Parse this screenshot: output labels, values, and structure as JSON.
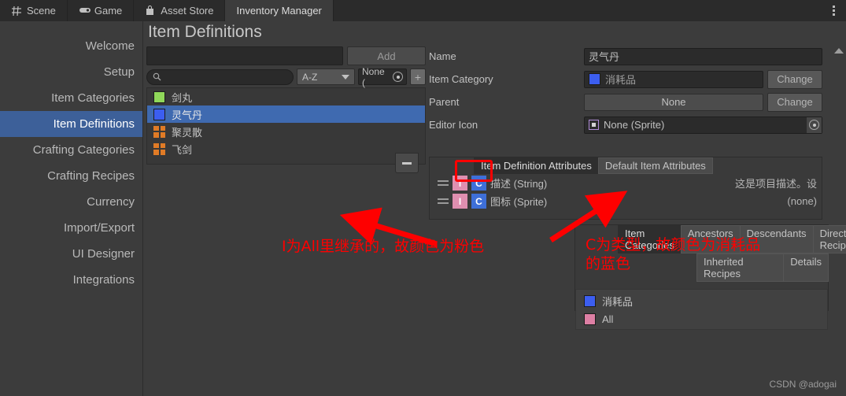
{
  "window": {
    "tabs": [
      {
        "label": "Scene",
        "icon": "grid-icon",
        "active": false
      },
      {
        "label": "Game",
        "icon": "gamepad-icon",
        "active": false
      },
      {
        "label": "Asset Store",
        "icon": "store-bag-icon",
        "active": false
      },
      {
        "label": "Inventory Manager",
        "icon": "none",
        "active": true
      }
    ],
    "menu_icon": "kebab-menu-icon"
  },
  "page_title": "Item Definitions",
  "sidebar": {
    "items": [
      {
        "label": "Welcome",
        "active": false
      },
      {
        "label": "Setup",
        "active": false
      },
      {
        "label": "Item Categories",
        "active": false
      },
      {
        "label": "Item Definitions",
        "active": true
      },
      {
        "label": "Crafting Categories",
        "active": false
      },
      {
        "label": "Crafting Recipes",
        "active": false
      },
      {
        "label": "Currency",
        "active": false
      },
      {
        "label": "Import/Export",
        "active": false
      },
      {
        "label": "UI Designer",
        "active": false
      },
      {
        "label": "Integrations",
        "active": false
      }
    ]
  },
  "item_pane": {
    "new_item_value": "",
    "new_item_placeholder": "",
    "add_label": "Add",
    "search_value": "",
    "search_placeholder": "",
    "search_icon": "search-icon",
    "sort_value": "A-Z",
    "filter_value": "None (",
    "filter_icon": "radio-select-icon",
    "add_filter_label": "+",
    "remove_label": "-",
    "items": [
      {
        "label": "剑丸",
        "icon": "color-swatch",
        "color": "#90d85a",
        "selected": false
      },
      {
        "label": "灵气丹",
        "icon": "color-swatch",
        "color": "#3c5ef0",
        "selected": true
      },
      {
        "label": "聚灵散",
        "icon": "grid-swatch",
        "color": "#e07b26",
        "selected": false
      },
      {
        "label": "飞剑",
        "icon": "grid-swatch",
        "color": "#e07b26",
        "selected": false
      }
    ]
  },
  "properties": {
    "name_label": "Name",
    "name_value": "灵气丹",
    "category_label": "Item Category",
    "category_value": "消耗品",
    "category_color": "#3c5ef0",
    "category_change_label": "Change",
    "parent_label": "Parent",
    "parent_value": "None",
    "parent_change_label": "Change",
    "editor_icon_label": "Editor Icon",
    "editor_icon_value": "None (Sprite)",
    "editor_icon_picker": "object-picker-icon"
  },
  "attributes": {
    "tabs": [
      {
        "label": "Item Definition Attributes",
        "active": true
      },
      {
        "label": "Default Item Attributes",
        "active": false
      }
    ],
    "rows": [
      {
        "badge_i": "I",
        "badge_c": "C",
        "name": "描述 (String)",
        "value": "这是项目描述。设"
      },
      {
        "badge_i": "I",
        "badge_c": "C",
        "name": "图标 (Sprite)",
        "value": "(none)"
      }
    ],
    "badge_i_color": "#df8fb0",
    "badge_c_color": "#3e6fd8"
  },
  "categories_panel": {
    "tabs_row1": [
      {
        "label": "Item Categories",
        "active": true
      },
      {
        "label": "Ancestors",
        "active": false
      },
      {
        "label": "Descendants",
        "active": false
      },
      {
        "label": "Direct Recipes",
        "active": false
      }
    ],
    "tabs_row2": [
      {
        "label": "Inherited Recipes",
        "active": false
      },
      {
        "label": "Details",
        "active": false
      }
    ],
    "entries": [
      {
        "label": "消耗品",
        "color": "#3c5ef0"
      },
      {
        "label": "All",
        "color": "#dd7fa4"
      }
    ]
  },
  "annotations": [
    {
      "text": "I为All里继承的，故颜色为粉色",
      "color": "#fe0000"
    },
    {
      "text": "C为类型，故颜色为消耗品\n的蓝色",
      "color": "#fe0000"
    }
  ],
  "watermark": "CSDN @adogai"
}
